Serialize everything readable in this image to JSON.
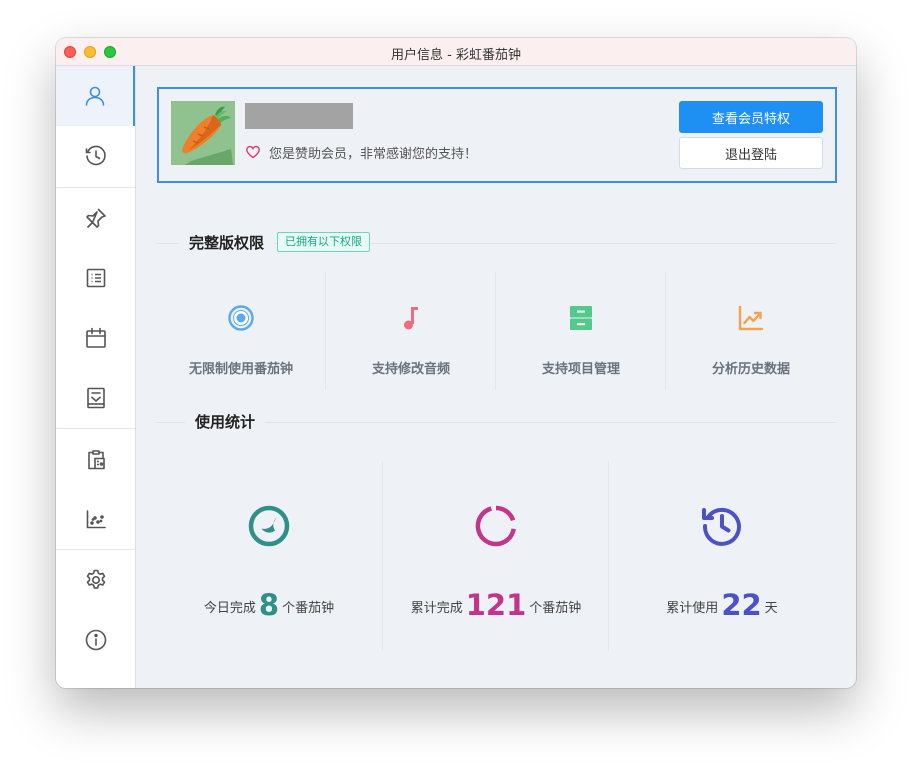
{
  "window": {
    "title": "用户信息 - 彩虹番茄钟"
  },
  "sidebar": {
    "items": [
      {
        "icon": "user-icon",
        "active": true
      },
      {
        "icon": "clock-icon"
      },
      {
        "icon": "pin-icon"
      },
      {
        "icon": "list-icon"
      },
      {
        "icon": "calendar-icon"
      },
      {
        "icon": "inbox-icon"
      },
      {
        "icon": "clipboard-icon"
      },
      {
        "icon": "scatter-chart-icon"
      },
      {
        "icon": "gear-icon"
      },
      {
        "icon": "info-icon"
      }
    ]
  },
  "profile": {
    "sponsor_text": "您是赞助会员，非常感谢您的支持！",
    "view_perks_label": "查看会员特权",
    "logout_label": "退出登陆"
  },
  "privileges": {
    "title": "完整版权限",
    "badge": "已拥有以下权限",
    "items": [
      {
        "label": "无限制使用番茄钟",
        "icon": "target-icon",
        "color": "#5aa9ee"
      },
      {
        "label": "支持修改音频",
        "icon": "music-note-icon",
        "color": "#f16b7b"
      },
      {
        "label": "支持项目管理",
        "icon": "archive-icon",
        "color": "#53c98a"
      },
      {
        "label": "分析历史数据",
        "icon": "line-chart-icon",
        "color": "#f4a24d"
      }
    ]
  },
  "stats": {
    "title": "使用统计",
    "items": [
      {
        "prefix": "今日完成",
        "value": "8",
        "suffix": "个番茄钟",
        "icon": "moon-clock-icon",
        "color": "#2f8f8a"
      },
      {
        "prefix": "累计完成",
        "value": "121",
        "suffix": "个番茄钟",
        "icon": "dashed-circle-icon",
        "color": "#c2358b"
      },
      {
        "prefix": "累计使用",
        "value": "22",
        "suffix": "天",
        "icon": "history-icon",
        "color": "#4a52c6"
      }
    ]
  },
  "colors": {
    "accent": "#1e8ff3",
    "sidebar_active": "#3d8ee8"
  }
}
